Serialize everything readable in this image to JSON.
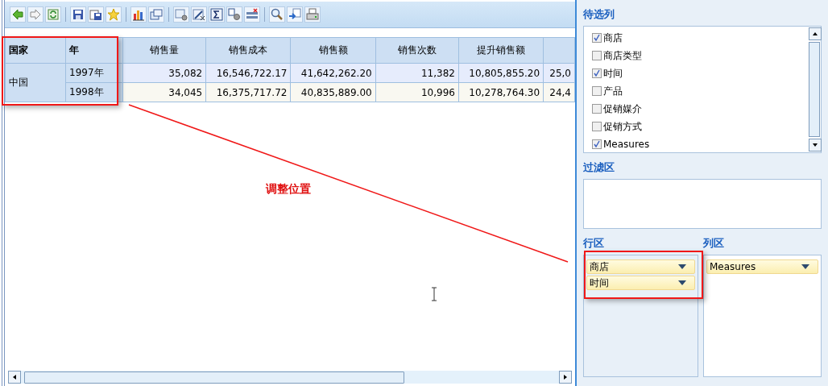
{
  "table": {
    "row_headers": [
      "国家",
      "年"
    ],
    "columns": [
      "销售量",
      "销售成本",
      "销售额",
      "销售次数",
      "提升销售额"
    ],
    "groups": [
      {
        "label": "中国",
        "rows": [
          {
            "year": "1997年",
            "values": [
              "35,082",
              "16,546,722.17",
              "41,642,262.20",
              "11,382",
              "10,805,855.20",
              "25,0"
            ]
          },
          {
            "year": "1998年",
            "values": [
              "34,045",
              "16,375,717.72",
              "40,835,889.00",
              "10,996",
              "10,278,764.30",
              "24,4"
            ]
          }
        ]
      }
    ]
  },
  "annotation": {
    "text": "调整位置"
  },
  "available_columns": {
    "title": "待选列",
    "items": [
      {
        "label": "商店",
        "checked": true
      },
      {
        "label": "商店类型",
        "checked": false
      },
      {
        "label": "时间",
        "checked": true
      },
      {
        "label": "产品",
        "checked": false
      },
      {
        "label": "促销媒介",
        "checked": false
      },
      {
        "label": "促销方式",
        "checked": false
      },
      {
        "label": "Measures",
        "checked": true
      }
    ]
  },
  "filter_area": {
    "title": "过滤区"
  },
  "row_area": {
    "title": "行区",
    "items": [
      "商店",
      "时间"
    ]
  },
  "column_area": {
    "title": "列区",
    "items": [
      "Measures"
    ]
  }
}
